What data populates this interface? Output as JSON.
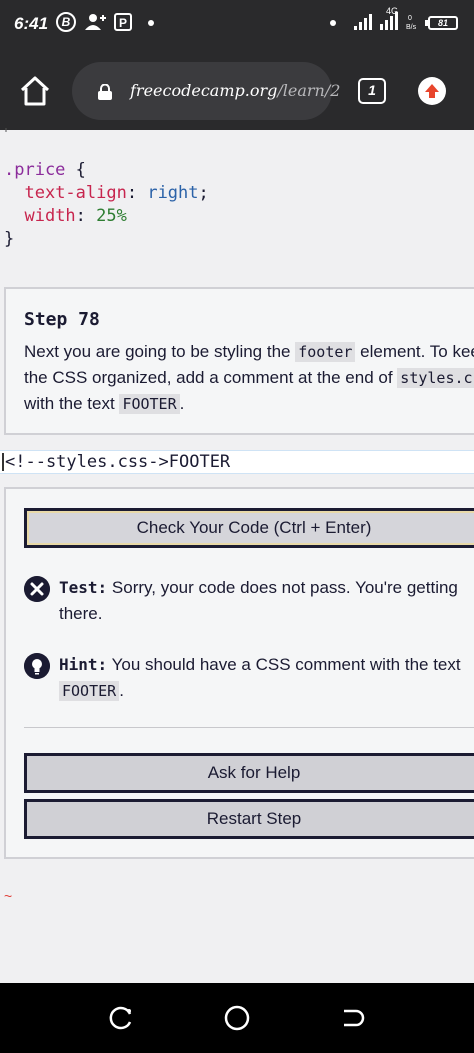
{
  "status_bar": {
    "time": "6:41",
    "circle_icon_letter": "B",
    "network_label": "4G",
    "battery": "81"
  },
  "browser": {
    "url_domain": "freecodecamp.org",
    "url_path": "/learn/2",
    "tab_count": "1"
  },
  "code_snippet": {
    "selector": ".price",
    "open_brace": " {",
    "line1_prop": "text-align",
    "line1_value": "right",
    "line2_prop": "width",
    "line2_value": "25%",
    "close_brace": "}"
  },
  "step": {
    "title": "Step 78",
    "text_part1": "Next you are going to be styling the ",
    "code1": "footer",
    "text_part2": " element. To kee",
    "text_part3": "the CSS organized, add a comment at the end of ",
    "code2": "styles.css",
    "text_part4": "with the text ",
    "code3": "FOOTER",
    "text_part5": "."
  },
  "editor": {
    "line": "<!--styles.css->FOOTER"
  },
  "result": {
    "check_button": "Check Your Code (Ctrl + Enter)",
    "test_label": "Test:",
    "test_text": " Sorry, your code does not pass. You're getting there.",
    "hint_label": "Hint:",
    "hint_text": " You should have a CSS comment with the text ",
    "hint_code": "FOOTER",
    "hint_end": ".",
    "help_button": "Ask for Help",
    "restart_button": "Restart Step"
  },
  "squiggle": "~",
  "colors": {
    "chrome_bg": "#2a2a2c",
    "upload_accent": "#e8452c",
    "panel_border": "#d0d0d5",
    "button_border": "#1b1b32"
  }
}
